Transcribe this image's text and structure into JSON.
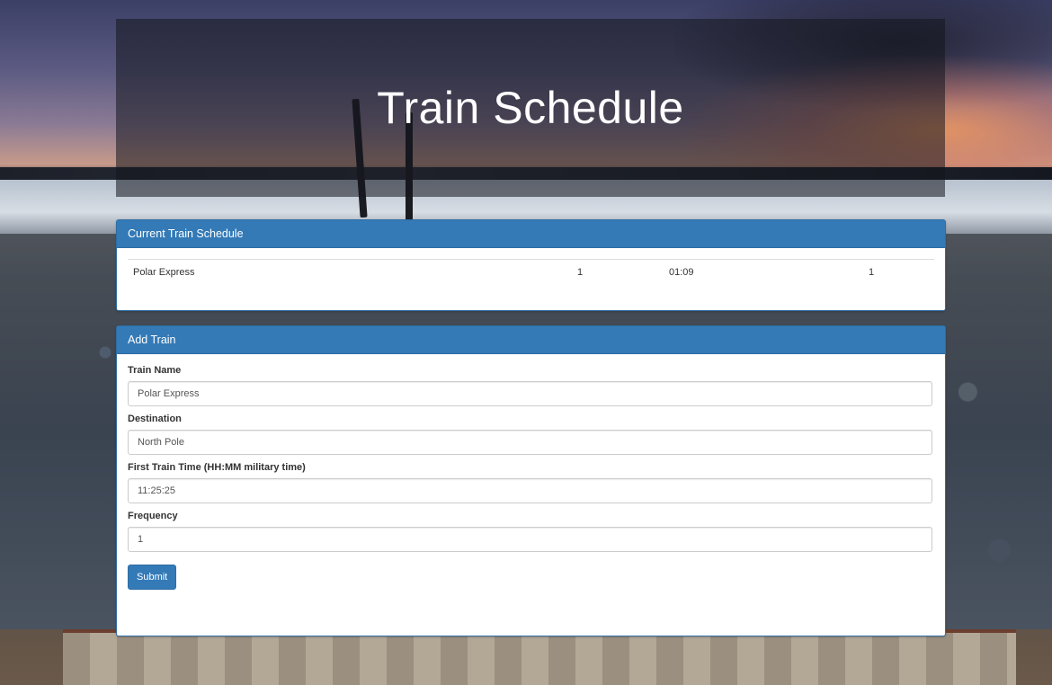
{
  "header": {
    "title": "Train Schedule"
  },
  "schedule": {
    "heading": "Current Train Schedule",
    "rows": [
      {
        "name": "Polar Express",
        "destination": "1",
        "next_arrival": "01:09",
        "minutes_away": "1"
      }
    ]
  },
  "add_train": {
    "heading": "Add Train",
    "fields": {
      "train_name": {
        "label": "Train Name",
        "value": "Polar Express"
      },
      "destination": {
        "label": "Destination",
        "value": "North Pole"
      },
      "first_time": {
        "label": "First Train Time (HH:MM military time)",
        "value": "11:25:25"
      },
      "frequency": {
        "label": "Frequency",
        "value": "1"
      }
    },
    "submit_label": "Submit"
  },
  "colors": {
    "primary": "#337ab7",
    "panel_border": "#2e6da4"
  }
}
